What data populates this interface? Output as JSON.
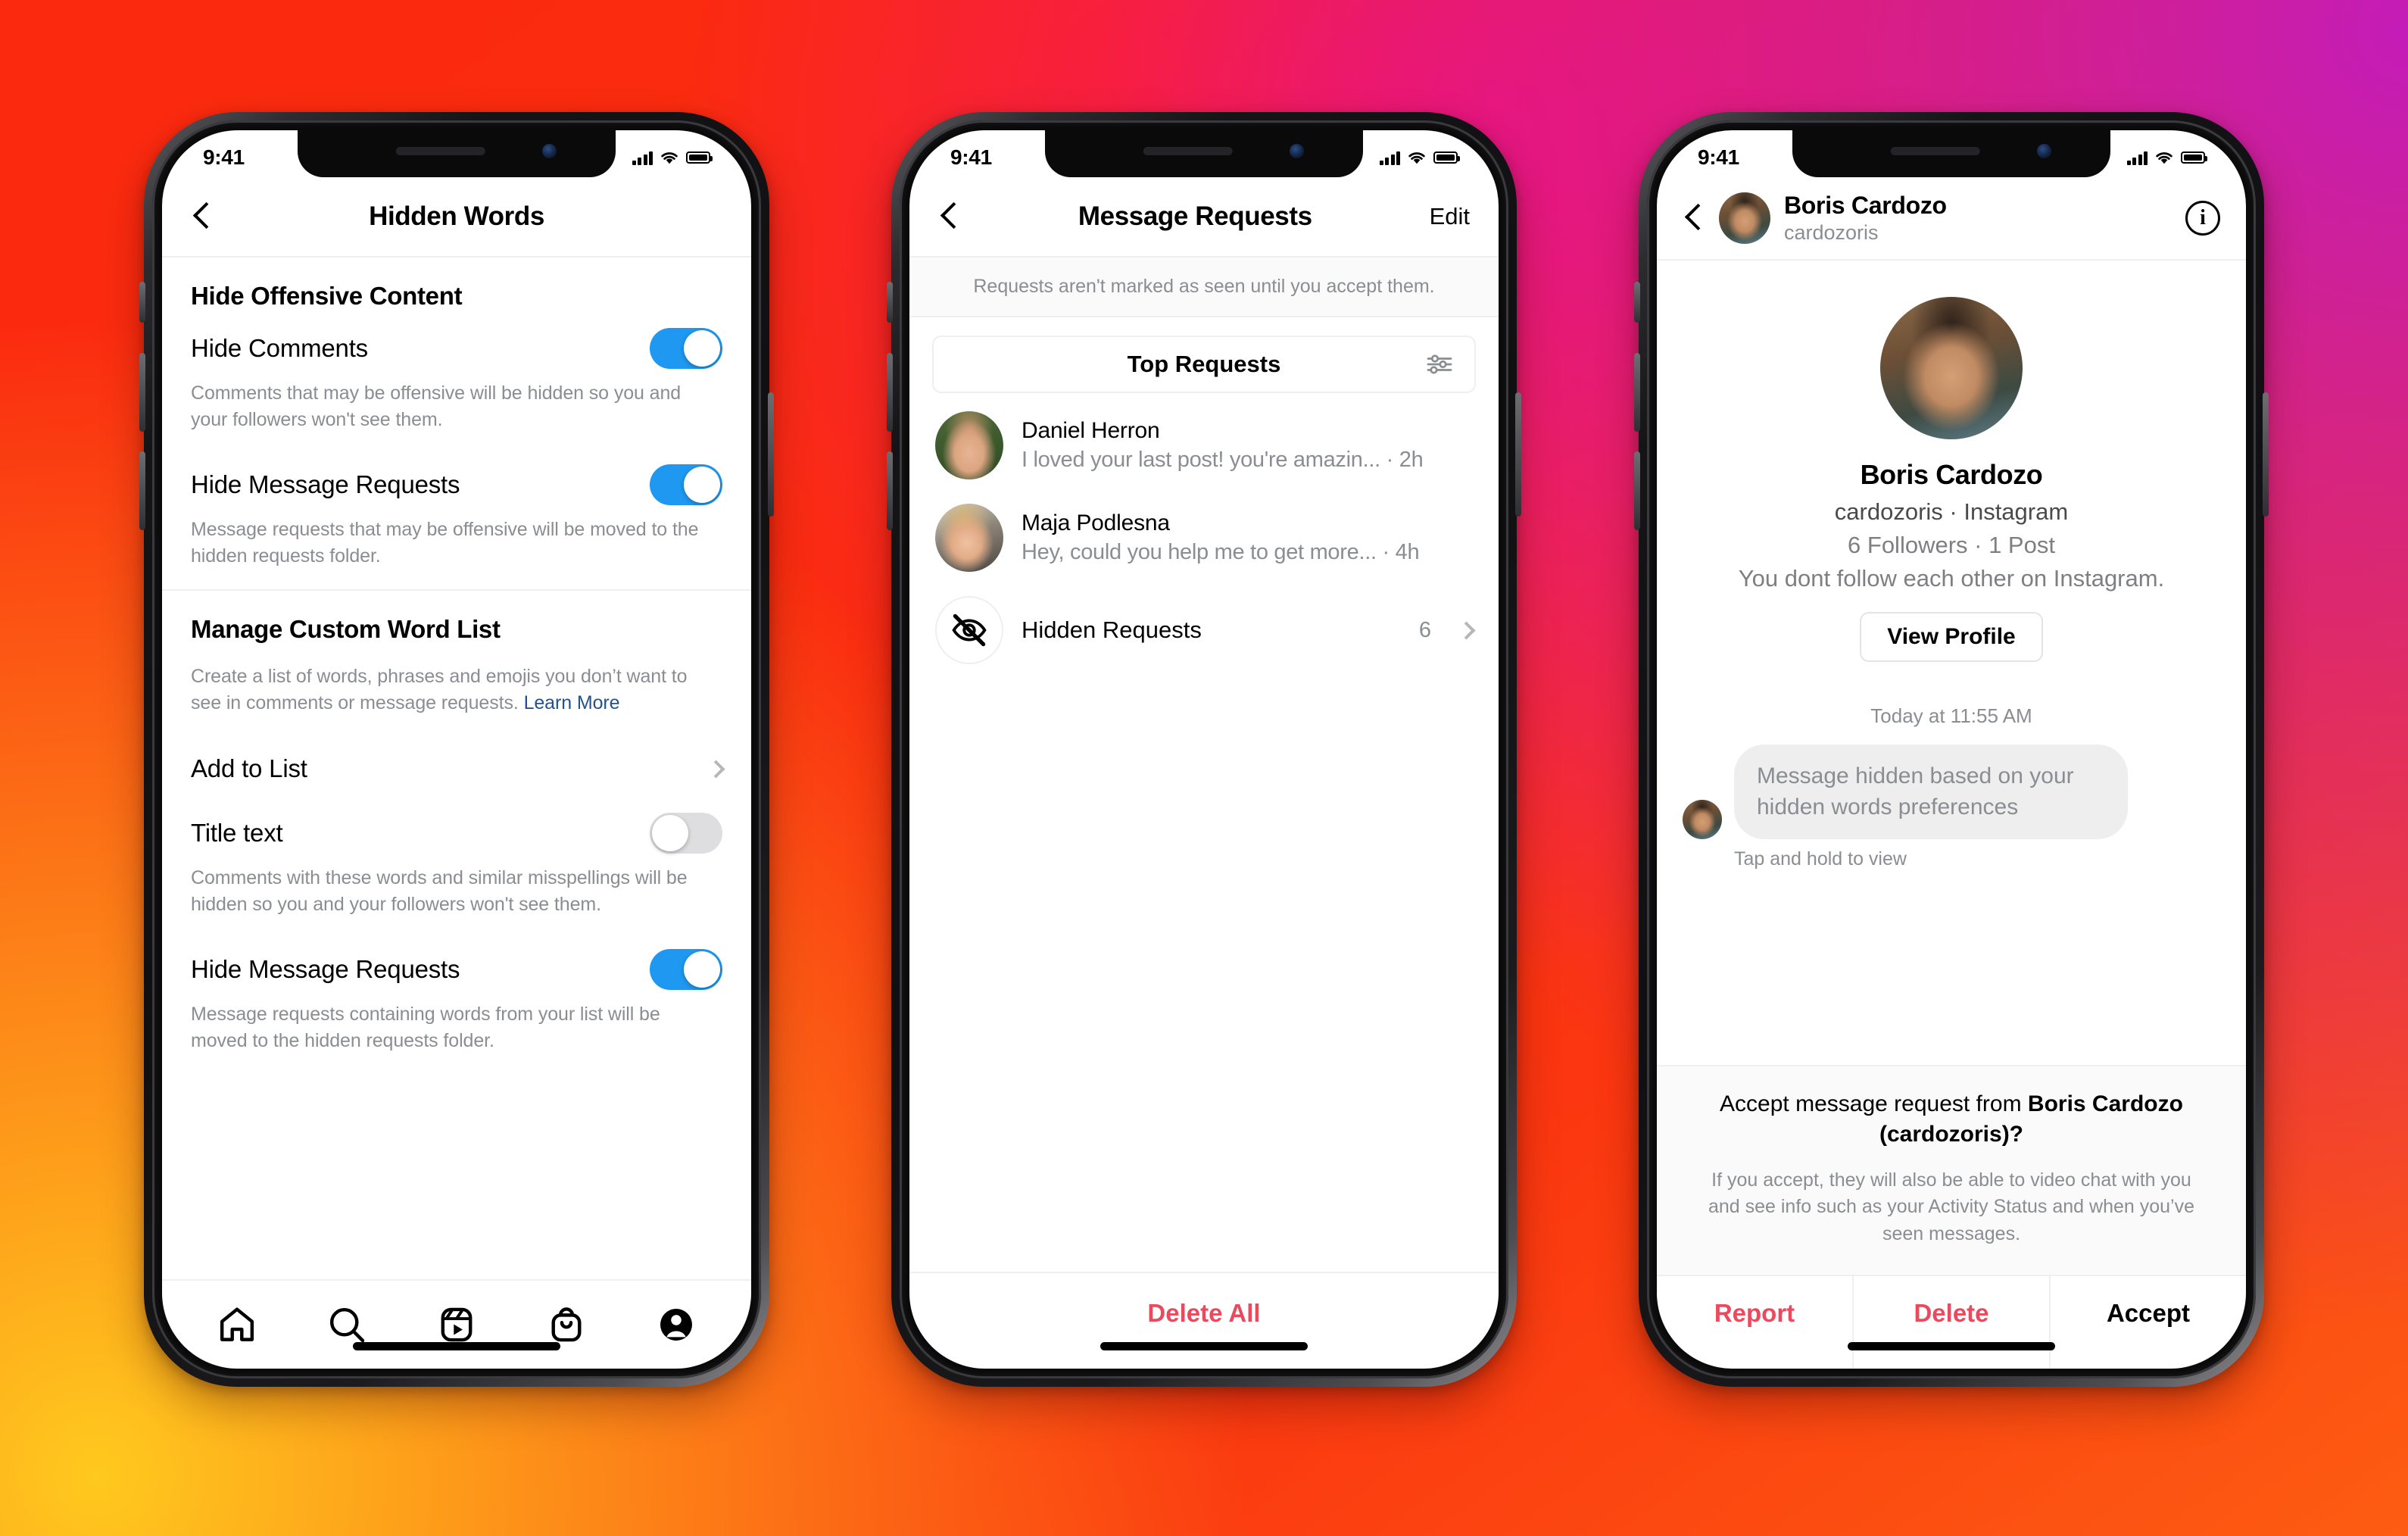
{
  "background": {
    "colors": [
      "#FA2B10",
      "#C41CB8",
      "#F4136B",
      "#FFC91E"
    ]
  },
  "status_bar": {
    "time": "9:41"
  },
  "phone1": {
    "nav": {
      "title": "Hidden Words",
      "back_icon": "chevron-left-icon"
    },
    "section1": {
      "title": "Hide Offensive Content",
      "rows": [
        {
          "label": "Hide Comments",
          "toggle": "on",
          "description": "Comments that may be offensive will be hidden so you and your followers won't see them."
        },
        {
          "label": "Hide Message Requests",
          "toggle": "on",
          "description": "Message requests that may be offensive will be moved to the hidden requests folder."
        }
      ]
    },
    "section2": {
      "title": "Manage Custom Word List",
      "description": "Create a list of words, phrases and emojis you don’t want to see in comments or message requests.",
      "learn_more": "Learn More",
      "add_to_list": "Add to List",
      "rows": [
        {
          "label": "Title text",
          "toggle": "off",
          "description": "Comments with these words and similar misspellings will be hidden so you and your followers won't see them."
        },
        {
          "label": "Hide Message Requests",
          "toggle": "on",
          "description": "Message requests containing words from your list will be moved to the hidden requests folder."
        }
      ]
    },
    "tabbar": [
      {
        "name": "home-icon"
      },
      {
        "name": "search-icon"
      },
      {
        "name": "reels-icon"
      },
      {
        "name": "shop-icon"
      },
      {
        "name": "profile-icon"
      }
    ]
  },
  "phone2": {
    "nav": {
      "title": "Message Requests",
      "back_icon": "chevron-left-icon",
      "action": "Edit"
    },
    "notice": "Requests aren't marked as seen until you accept them.",
    "filter": {
      "label": "Top Requests",
      "icon": "sliders-icon"
    },
    "requests": [
      {
        "name": "Daniel Herron",
        "preview": "I loved your last post! you're amazin...",
        "time": "2h",
        "avatar": "daniel-avatar"
      },
      {
        "name": "Maja Podlesna",
        "preview": "Hey, could you help me to get more...",
        "time": "4h",
        "avatar": "maja-avatar"
      }
    ],
    "hidden_requests": {
      "label": "Hidden Requests",
      "count": "6",
      "icon": "eye-off-icon"
    },
    "footer": {
      "delete_all": "Delete All"
    }
  },
  "phone3": {
    "nav": {
      "back_icon": "chevron-left-icon",
      "name": "Boris Cardozo",
      "handle": "cardozoris",
      "info_icon": "info-icon"
    },
    "profile": {
      "name": "Boris Cardozo",
      "subtitle": "cardozoris · Instagram",
      "stats": "6 Followers · 1 Post",
      "note": "You dont follow each other on Instagram.",
      "view_profile": "View Profile"
    },
    "chat": {
      "timestamp": "Today at 11:55 AM",
      "bubble": "Message hidden based on your hidden words preferences",
      "hint": "Tap and hold to view"
    },
    "accept": {
      "question_prefix": "Accept message request from ",
      "question_name": "Boris Cardozo (cardozoris)?",
      "description": "If you accept, they will also be able to video chat with you and see info such as your Activity Status and when you’ve seen messages.",
      "actions": [
        "Report",
        "Delete",
        "Accept"
      ]
    }
  }
}
